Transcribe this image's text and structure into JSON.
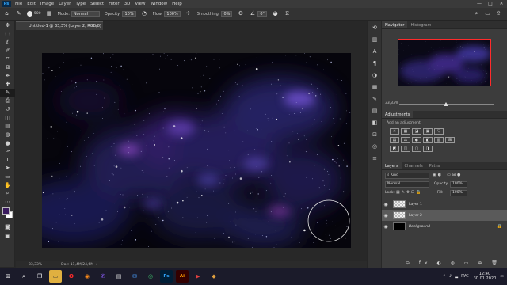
{
  "menubar": {
    "logo": "Ps",
    "items": [
      "File",
      "Edit",
      "Image",
      "Layer",
      "Type",
      "Select",
      "Filter",
      "3D",
      "View",
      "Window",
      "Help"
    ],
    "window_controls": [
      "—",
      "□",
      "✕"
    ]
  },
  "options_bar": {
    "brush_size": "500",
    "mode_label": "Mode:",
    "mode_value": "Normal",
    "opacity_label": "Opacity:",
    "opacity_value": "10%",
    "flow_label": "Flow:",
    "flow_value": "100%",
    "smoothing_label": "Smoothing:",
    "smoothing_value": "0%",
    "angle_value": "0°"
  },
  "document": {
    "tab_title": "Untitled-1 @ 33,3% (Layer 2, RGB/8) *",
    "tab_close": "×",
    "zoom": "33,33%",
    "doc_info": "Doc: 11,4M/24,6M"
  },
  "colors": {
    "foreground": "#3a1b5e",
    "background": "#ffffff",
    "accent": "#31a8ff",
    "nav_frame": "#ff2b2b"
  },
  "navigator": {
    "tabs": [
      "Navigator",
      "Histogram"
    ],
    "zoom": "33,33%"
  },
  "adjustments": {
    "tab": "Adjustments",
    "add_label": "Add an adjustment",
    "icons_row1": [
      "☀",
      "▦",
      "◪",
      "▣",
      "▽"
    ],
    "icons_row2": [
      "▤",
      "⚖",
      "◐",
      "◧",
      "▥",
      "⊞"
    ],
    "icons_row3": [
      "◩",
      "◫",
      "▢",
      "◨"
    ]
  },
  "layers": {
    "tabs": [
      "Layers",
      "Channels",
      "Paths"
    ],
    "kind_label": "Kind",
    "blend_mode": "Normal",
    "opacity_label": "Opacity:",
    "opacity_value": "100%",
    "lock_label": "Lock:",
    "fill_label": "Fill:",
    "fill_value": "100%",
    "items": [
      {
        "name": "Layer 1",
        "thumb": "checker",
        "selected": false
      },
      {
        "name": "Layer 2",
        "thumb": "checker",
        "selected": true
      },
      {
        "name": "Background",
        "thumb": "black",
        "selected": false
      }
    ]
  },
  "taskbar": {
    "apps": [
      {
        "icon": "windows-icon",
        "glyph": "⊞"
      },
      {
        "icon": "search-icon",
        "glyph": "⌕"
      },
      {
        "icon": "task-view-icon",
        "glyph": "❐"
      },
      {
        "icon": "folder-icon",
        "glyph": "▭"
      },
      {
        "icon": "opera-icon",
        "glyph": "O"
      },
      {
        "icon": "firefox-icon",
        "glyph": "◉"
      },
      {
        "icon": "viber-icon",
        "glyph": "✆"
      },
      {
        "icon": "explorer-icon",
        "glyph": "▤"
      },
      {
        "icon": "mail-icon",
        "glyph": "✉"
      },
      {
        "icon": "chrome-icon",
        "glyph": "◎"
      },
      {
        "icon": "photoshop-icon",
        "glyph": "Ps"
      },
      {
        "icon": "illustrator-icon",
        "glyph": "Ai"
      },
      {
        "icon": "media-icon",
        "glyph": "▶"
      },
      {
        "icon": "app-icon",
        "glyph": "◆"
      }
    ],
    "language": "РУС",
    "time": "12:40",
    "date": "30.01.2020"
  }
}
